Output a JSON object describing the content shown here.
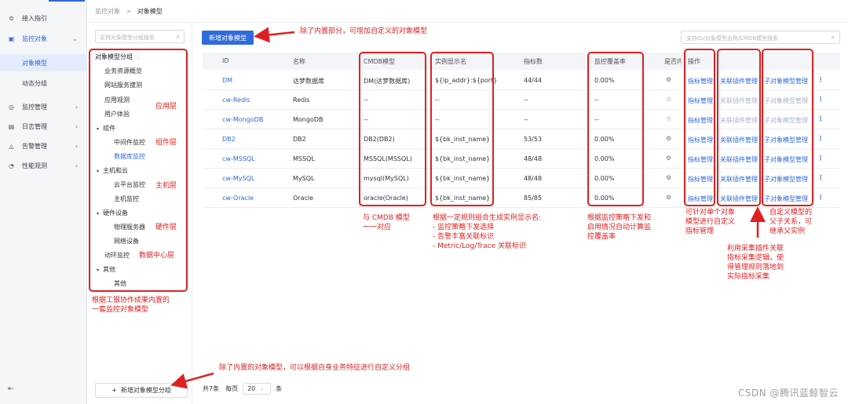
{
  "nav": {
    "items": [
      {
        "label": "接入指引",
        "icon": "plug-icon",
        "chevron": false
      },
      {
        "label": "监控对象",
        "icon": "monitor-icon",
        "chevron": true,
        "expanded": true
      },
      {
        "label": "监控管理",
        "icon": "gauge-icon",
        "chevron": true
      },
      {
        "label": "日志管理",
        "icon": "log-icon",
        "chevron": true
      },
      {
        "label": "告警管理",
        "icon": "alarm-icon",
        "chevron": true
      },
      {
        "label": "性能观测",
        "icon": "speedometer-icon",
        "chevron": true
      }
    ],
    "subitems": [
      {
        "label": "对象模型",
        "active": true
      },
      {
        "label": "动态分组",
        "active": false
      }
    ]
  },
  "breadcrumb": {
    "parent": "监控对象",
    "sep": ">",
    "current": "对象模型"
  },
  "tree": {
    "search_placeholder": "支持对象模型分组搜索",
    "header": "对象模型分组",
    "nodes": [
      {
        "label": "业务资源概览"
      },
      {
        "label": "网站服务拔测"
      },
      {
        "label": "应用观测"
      },
      {
        "label": "用户体验"
      },
      {
        "label": "组件",
        "caret": "▾"
      },
      {
        "label": "中间件监控"
      },
      {
        "label": "数据库监控",
        "selected": true
      },
      {
        "label": "主机和云",
        "caret": "▾"
      },
      {
        "label": "云平台监控"
      },
      {
        "label": "主机监控"
      },
      {
        "label": "硬件设备",
        "caret": "▾"
      },
      {
        "label": "物理服务器"
      },
      {
        "label": "网络设备"
      },
      {
        "label": "动环监控"
      },
      {
        "label": "其他",
        "caret": "▾"
      },
      {
        "label": "其他"
      }
    ],
    "add_button": "新增对象模型分组"
  },
  "toolbar": {
    "new_button": "新增对象模型",
    "search_placeholder": "支持ID/对象模型名称/CMDB模型搜索"
  },
  "table": {
    "columns": [
      "ID",
      "名称",
      "CMDB模型",
      "实例显示名",
      "指标数",
      "监控覆盖率",
      "是否内",
      "操作"
    ],
    "actions": [
      "指标管理",
      "关联插件管理",
      "子对象模型管理"
    ],
    "rows": [
      {
        "id": "DM",
        "name": "达梦数据库",
        "cmdb": "DM(达梦数据库)",
        "display": "${ip_addr}:${port}",
        "metrics": "44/44",
        "coverage": "0.00%",
        "builtin": true
      },
      {
        "id": "cw-Redis",
        "name": "Redis",
        "cmdb": "--",
        "display": "--",
        "metrics": "--",
        "coverage": "--",
        "builtin": false
      },
      {
        "id": "cw-MongoDB",
        "name": "MongoDB",
        "cmdb": "--",
        "display": "--",
        "metrics": "--",
        "coverage": "--",
        "builtin": false
      },
      {
        "id": "DB2",
        "name": "DB2",
        "cmdb": "DB2(DB2)",
        "display": "${bk_inst_name}",
        "metrics": "53/53",
        "coverage": "0.00%",
        "builtin": true
      },
      {
        "id": "cw-MSSQL",
        "name": "MSSQL",
        "cmdb": "MSSQL(MSSQL)",
        "display": "${bk_inst_name}",
        "metrics": "48/48",
        "coverage": "0.00%",
        "builtin": true
      },
      {
        "id": "cw-MySQL",
        "name": "MySQL",
        "cmdb": "mysql(MySQL)",
        "display": "${bk_inst_name}",
        "metrics": "48/48",
        "coverage": "0.00%",
        "builtin": true
      },
      {
        "id": "cw-Oracle",
        "name": "Oracle",
        "cmdb": "oracle(Oracle)",
        "display": "${bk_inst_name}",
        "metrics": "85/85",
        "coverage": "0.00%",
        "builtin": true
      }
    ]
  },
  "pager": {
    "total": "共7条",
    "per_page_label": "每页",
    "per_page": "20",
    "unit": "条"
  },
  "annotations": {
    "custom_model": "除了内置部分，可增加自定义的对象模型",
    "app_layer": "应用层",
    "component_layer": "组件层",
    "host_layer": "主机层",
    "hardware_layer": "硬件层",
    "dc_layer": "数据中心层",
    "builtin_set_line1": "根据工银协作成果内置的",
    "builtin_set_line2": "一套监控对象模型",
    "cmdb_line1": "与 CMDB 模型",
    "cmdb_line2": "一一对应",
    "display_line1": "根据一定规则组合生成实例显示名:",
    "display_line2": "- 监控策略下发选择",
    "display_line3": "- 告警丰富关联标识",
    "display_line4": "- Metric/Log/Trace 关联标识",
    "coverage_line1": "根据监控策略下发和",
    "coverage_line2": "启用情况自动计算监",
    "coverage_line3": "控覆盖率",
    "metric_line1": "可针对单个对象",
    "metric_line2": "模型进行自定义",
    "metric_line3": "指标管理",
    "plugin_line1": "利用采集插件关联",
    "plugin_line2": "指标采集逻辑，使",
    "plugin_line3": "得管理规则落地到",
    "plugin_line4": "实际指标采集",
    "child_line1": "自定义模型的",
    "child_line2": "父子关系，可",
    "child_line3": "继承父实例",
    "custom_group": "除了内置的对象模型，可以根据自身业务特征进行自定义分组"
  },
  "watermark": "CSDN @腾讯蓝鲸智云",
  "colors": {
    "accent": "#2f6bdb",
    "annotation": "#e02020"
  }
}
